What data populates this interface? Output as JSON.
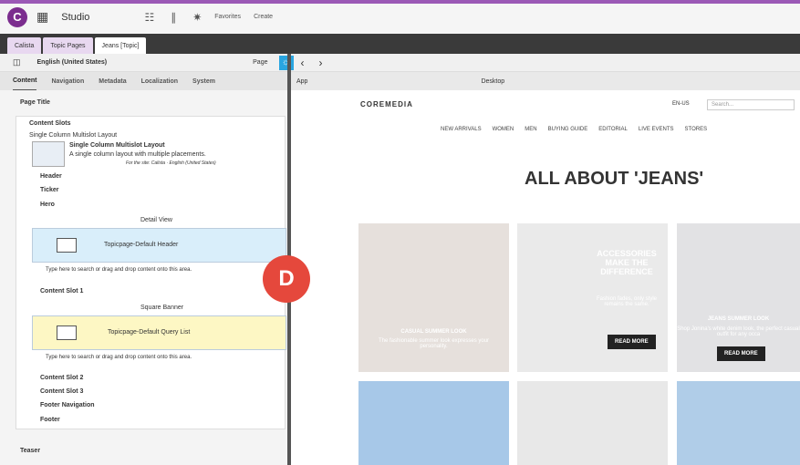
{
  "topbar": {
    "studio": "Studio",
    "favorites": "Favorites",
    "create": "Create"
  },
  "tabs": [
    "Calista",
    "Topic Pages",
    "Jeans [Topic]"
  ],
  "toolrow": {
    "locale": "English (United States)",
    "page": "Page"
  },
  "subtabs": [
    "Content",
    "Navigation",
    "Metadata",
    "Localization",
    "System"
  ],
  "left": {
    "page_title": "Page Title",
    "content_slots": "Content Slots",
    "layout_select": "Single Column Multislot Layout",
    "layout_name": "Single Column Multislot Layout",
    "layout_desc": "A single column layout with multiple placements.",
    "layout_site": "For the site: Calista · English (United States)",
    "header": "Header",
    "ticker": "Ticker",
    "hero": "Hero",
    "detail_view": "Detail View",
    "hero_item": "Topicpage-Default Header",
    "drop_hint": "Type here to search or drag and drop content onto this area.",
    "content_slot_1": "Content Slot 1",
    "square_banner": "Square Banner",
    "slot1_item": "Topicpage-Default Query List",
    "drop_hint2": "Type here to search or drag and drop content onto this area.",
    "content_slot_2": "Content Slot 2",
    "content_slot_3": "Content Slot 3",
    "footer_nav": "Footer Navigation",
    "footer": "Footer",
    "teaser": "Teaser"
  },
  "preview": {
    "app": "App",
    "device": "Desktop",
    "brand": "COREMEDIA",
    "locale": "EN-US",
    "search": "Search...",
    "nav": [
      "NEW ARRIVALS",
      "WOMEN",
      "MEN",
      "BUYING GUIDE",
      "EDITORIAL",
      "LIVE EVENTS",
      "STORES"
    ],
    "title": "ALL ABOUT 'JEANS'",
    "p1_title": "CASUAL SUMMER LOOK",
    "p1_text": "The fashionable summer look expresses your personality.",
    "p2_title": "ACCESSORIES MAKE THE DIFFERENCE",
    "p2_text": "Fashion fades, only style remains the same.",
    "p2_btn": "READ MORE",
    "p3_title": "JEANS SUMMER LOOK",
    "p3_text": "Shop Jonina's white denim look, the perfect casual outfit for any occa",
    "p3_btn": "READ MORE"
  },
  "badge": "D"
}
